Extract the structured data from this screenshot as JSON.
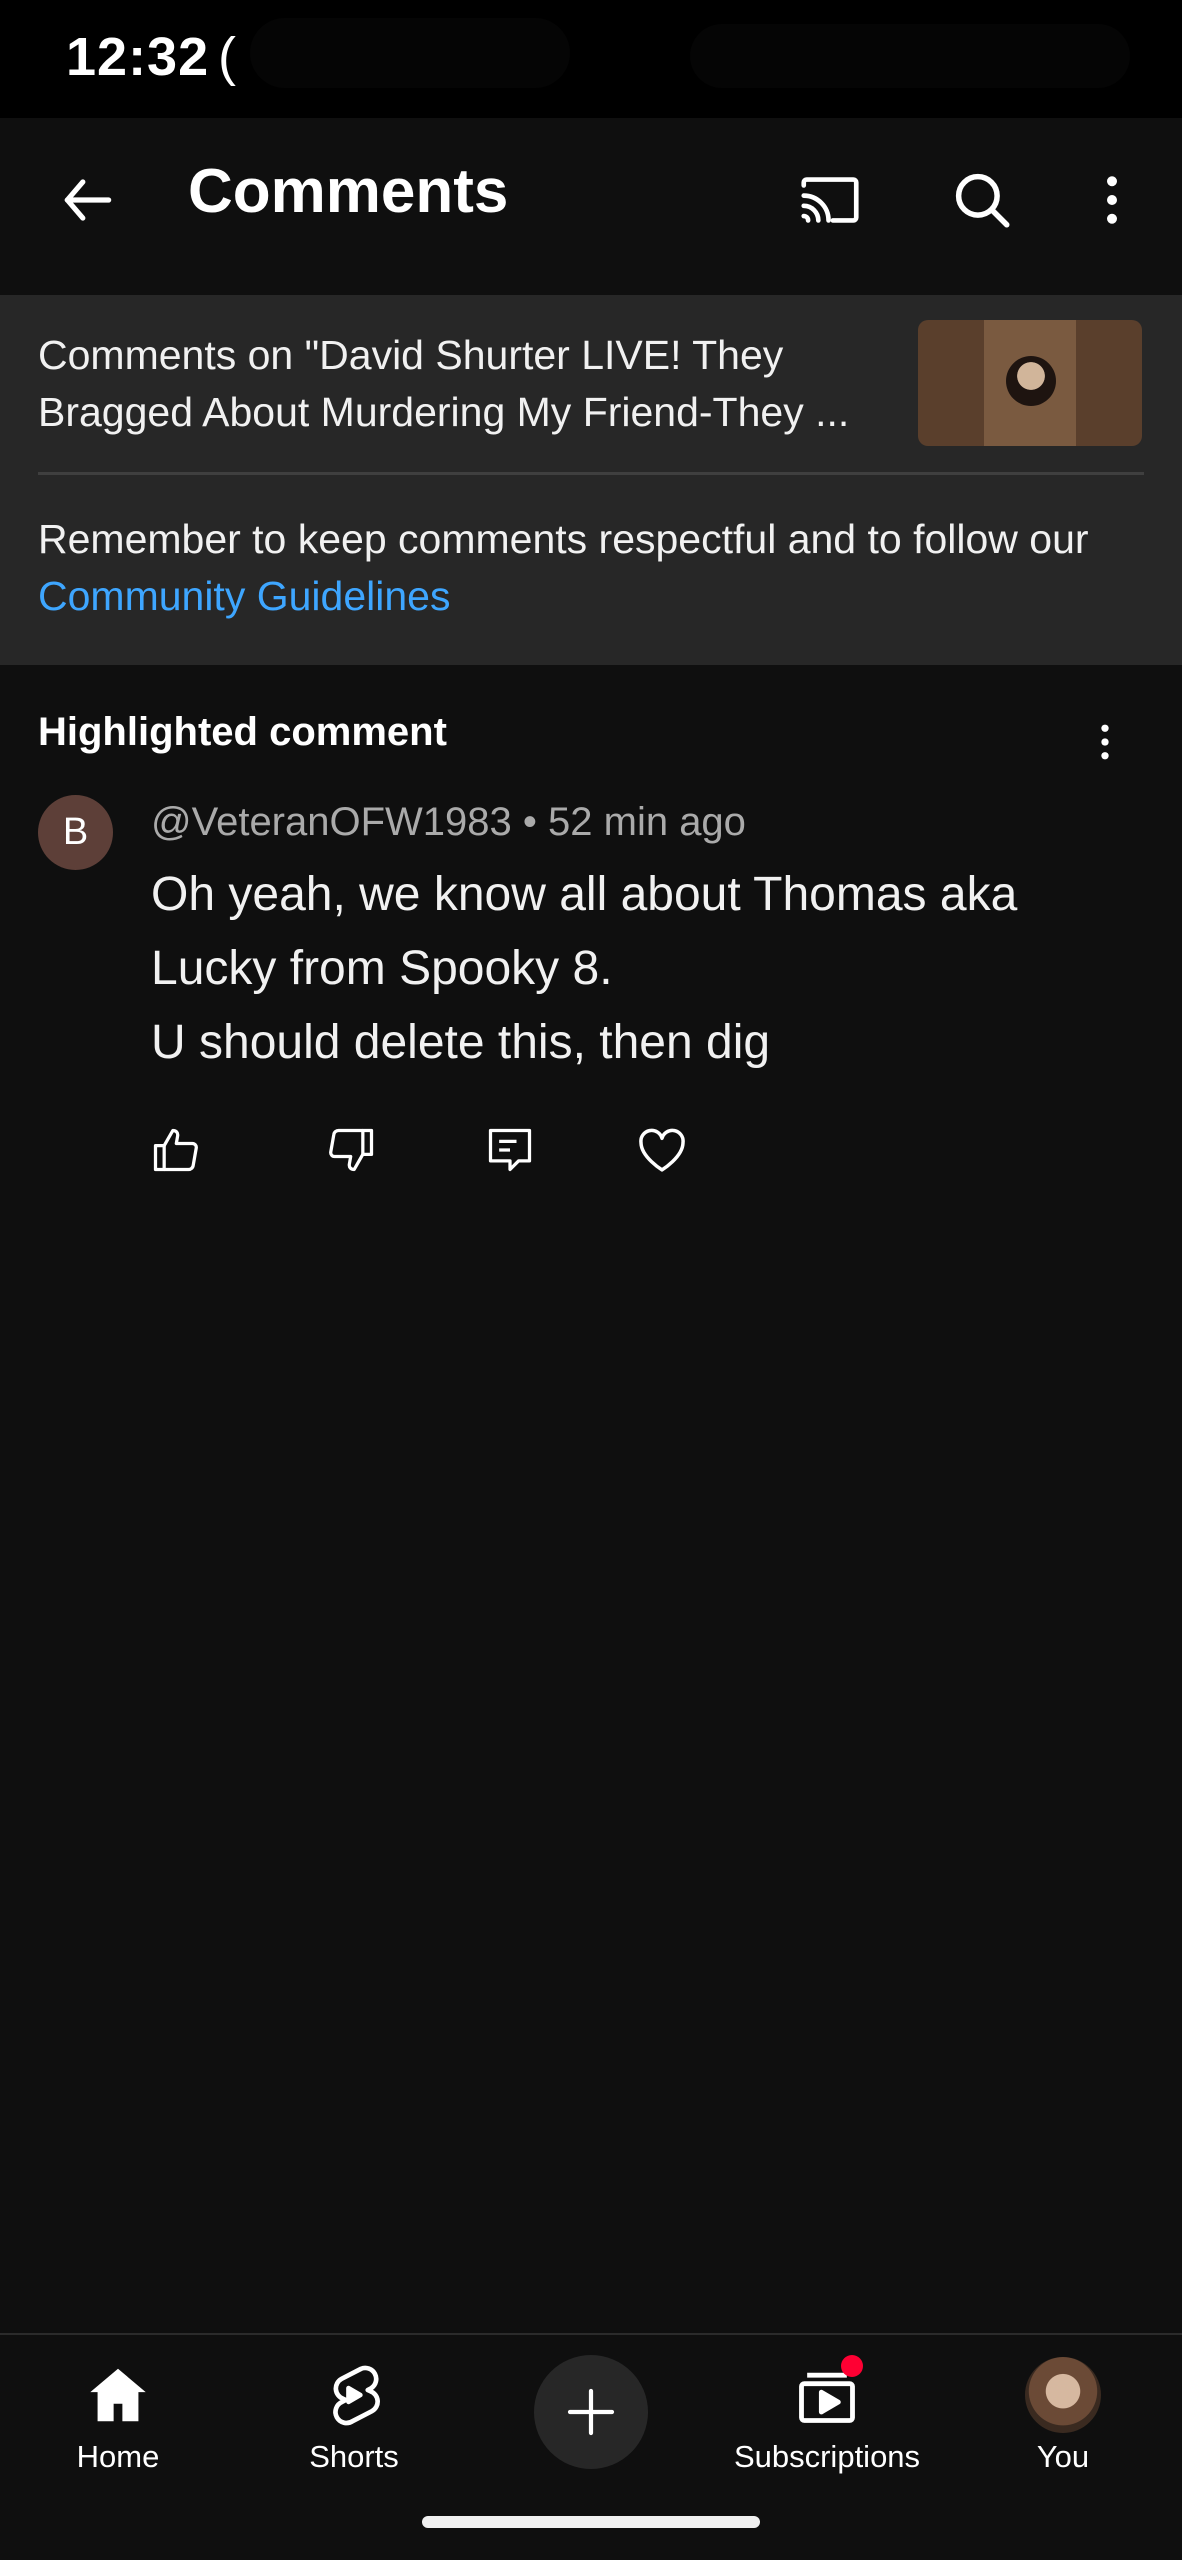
{
  "status_bar": {
    "time": "12:32",
    "extra": "("
  },
  "app_bar": {
    "title": "Comments",
    "back_icon": "arrow-left-icon",
    "cast_icon": "cast-icon",
    "search_icon": "search-icon",
    "more_icon": "more-vertical-icon"
  },
  "video_header": {
    "caption": "Comments on \"David Shurter LIVE! They Bragged About Murdering My Friend-They ...",
    "guidelines_prefix": "Remember to keep comments respectful and to follow our ",
    "guidelines_link": "Community Guidelines",
    "link_color": "#3ea6ff"
  },
  "highlighted": {
    "title": "Highlighted comment",
    "avatar_letter": "B",
    "avatar_color": "#5d3f38",
    "author": "@VeteranOFW1983",
    "separator": " • ",
    "time": "52 min ago",
    "text": "Oh yeah, we know all about Thomas aka Lucky from Spooky 8.\nU should delete this, then dig",
    "actions": [
      "like-icon",
      "dislike-icon",
      "reply-icon",
      "heart-icon"
    ]
  },
  "bottom_nav": {
    "items": [
      {
        "label": "Home",
        "icon": "home-icon"
      },
      {
        "label": "Shorts",
        "icon": "shorts-icon"
      },
      {
        "label": "",
        "icon": "create-plus-icon"
      },
      {
        "label": "Subscriptions",
        "icon": "subscriptions-icon"
      },
      {
        "label": "You",
        "icon": "you-avatar"
      }
    ],
    "badge_color": "#ff0033"
  }
}
